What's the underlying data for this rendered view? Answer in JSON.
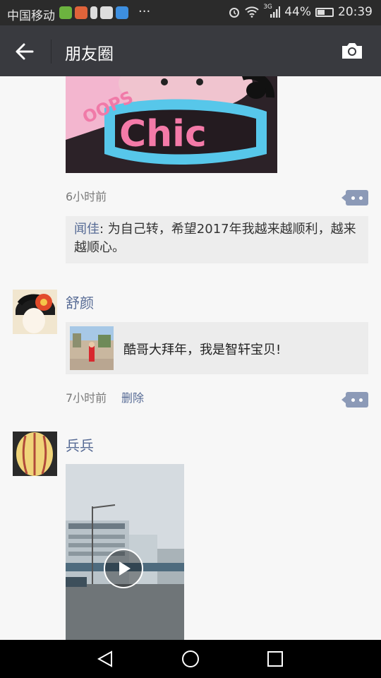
{
  "status_bar": {
    "carrier": "中国移动",
    "more": "···",
    "network": "3G",
    "battery": "44%",
    "time": "20:39"
  },
  "app_bar": {
    "title": "朋友圈"
  },
  "post1": {
    "image_text_top": "OOPS",
    "image_text_main": "Chic",
    "time": "6小时前",
    "comment": {
      "author": "闻佳",
      "separator": ": ",
      "text": "为自己转，希望2017年我越来越顺利，越来越顺心。"
    }
  },
  "post2": {
    "name": "舒颜",
    "share_text": "酷哥大拜年，我是智轩宝贝!",
    "time": "7小时前",
    "delete_label": "删除"
  },
  "post3": {
    "name": "兵兵"
  },
  "colors": {
    "app_bar": "#393a3f",
    "status_bar": "#2b2b2b",
    "link": "#576b95",
    "comment_bg": "#ededed",
    "page_bg": "#f7f7f7"
  }
}
